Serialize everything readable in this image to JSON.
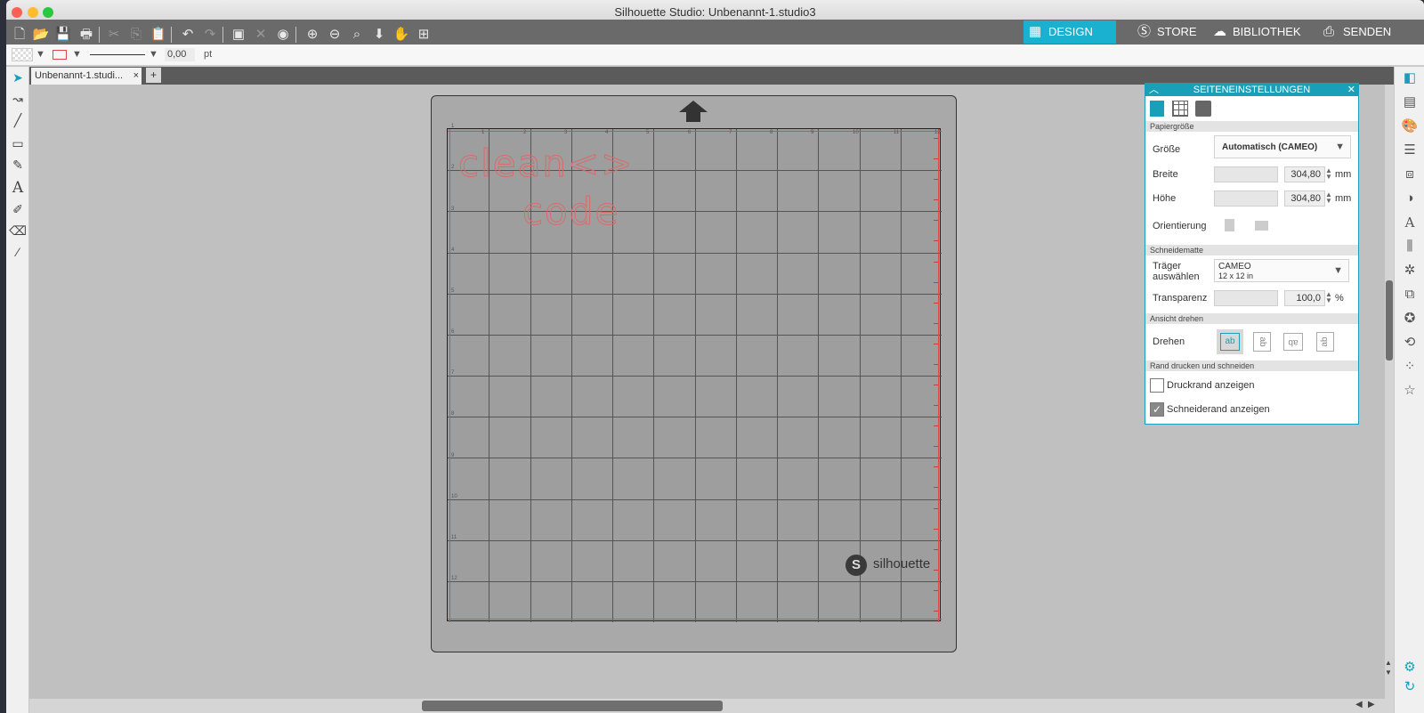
{
  "window": {
    "title": "Silhouette Studio: Unbenannt-1.studio3"
  },
  "nav": {
    "design": "DESIGN",
    "store": "STORE",
    "library": "BIBLIOTHEK",
    "send": "SENDEN"
  },
  "toolbar2": {
    "line_width": "0,00",
    "unit": "pt"
  },
  "tab": {
    "name": "Unbenannt-1.studi...",
    "close": "×",
    "add": "+"
  },
  "canvas": {
    "design_text_line1": "clean<>",
    "design_text_line2": "code",
    "ruler_numbers_top": [
      "1",
      "2",
      "3",
      "4",
      "5",
      "6",
      "7",
      "8",
      "9",
      "10",
      "11",
      "12"
    ],
    "ruler_numbers_left": [
      "1",
      "2",
      "3",
      "4",
      "5",
      "6",
      "7",
      "8",
      "9",
      "10",
      "11",
      "12"
    ],
    "brand": "silhouette"
  },
  "panel": {
    "title": "SEITENEINSTELLUNGEN",
    "section_paper": "Papiergröße",
    "size_label": "Größe",
    "size_value": "Automatisch (CAMEO)",
    "width_label": "Breite",
    "width_value": "304,80",
    "height_label": "Höhe",
    "height_value": "304,80",
    "unit_mm": "mm",
    "orientation_label": "Orientierung",
    "section_mat": "Schneidematte",
    "carrier_label_1": "Träger",
    "carrier_label_2": "auswählen",
    "carrier_value_1": "CAMEO",
    "carrier_value_2": "12 x 12 in",
    "transparency_label": "Transparenz",
    "transparency_value": "100,0",
    "unit_percent": "%",
    "section_view": "Ansicht drehen",
    "rotate_label": "Drehen",
    "rotate_options": [
      "ab",
      "ab",
      "ab",
      "ab"
    ],
    "section_border": "Rand drucken und schneiden",
    "print_border_label": "Druckrand anzeigen",
    "print_border_checked": false,
    "cut_border_label": "Schneiderand anzeigen",
    "cut_border_checked": true
  },
  "colors": {
    "accent": "#1a9fb8",
    "nav_bg": "#666666",
    "cut_line": "#e04848"
  }
}
